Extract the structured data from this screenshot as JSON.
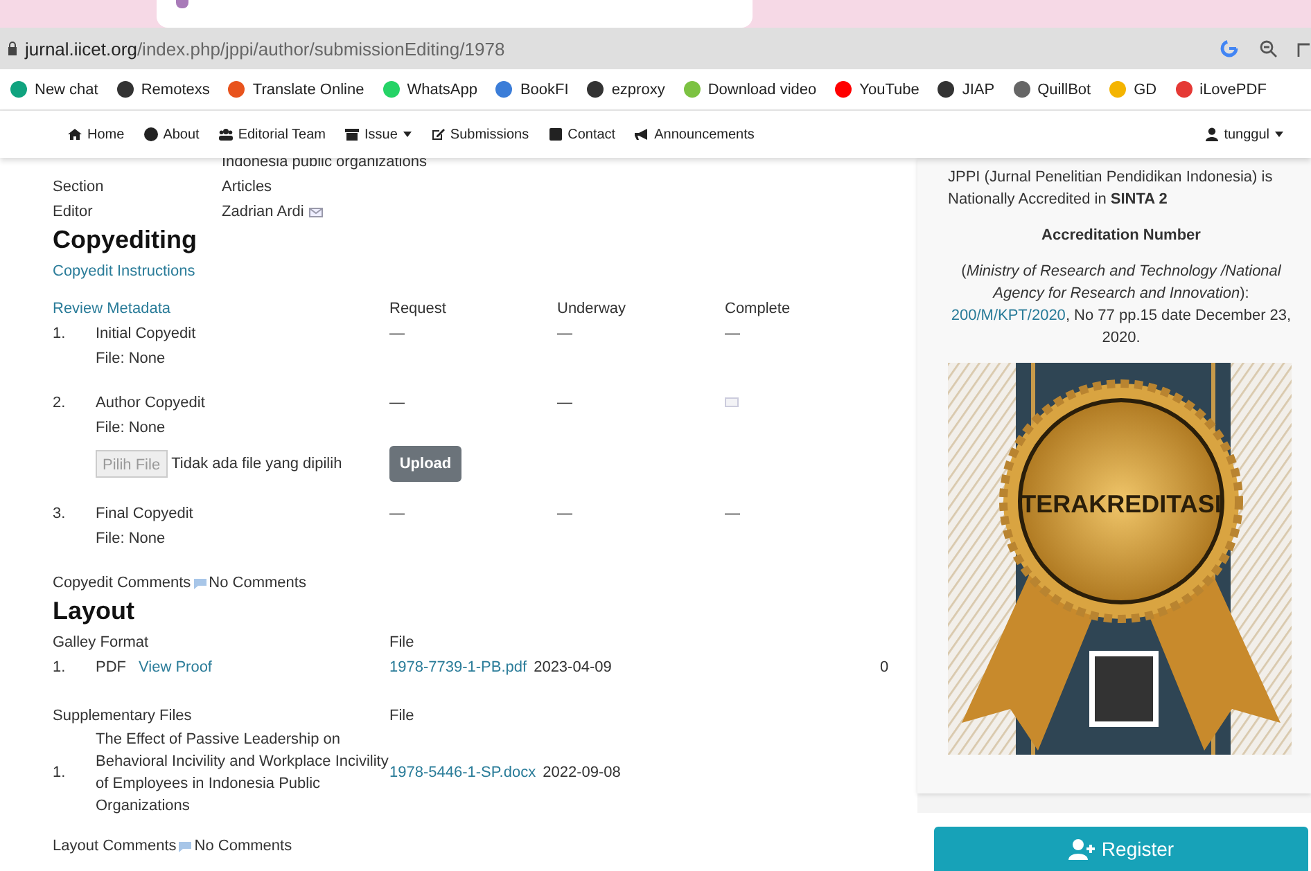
{
  "browser": {
    "url_host": "jurnal.iicet.org",
    "url_path": "/index.php/jppi/author/submissionEditing/1978",
    "bookmarks": [
      "New chat",
      "Remotexs",
      "Translate Online",
      "WhatsApp",
      "BookFI",
      "ezproxy",
      "Download video",
      "YouTube",
      "JIAP",
      "QuillBot",
      "GD",
      "iLovePDF"
    ]
  },
  "nav": {
    "items": [
      {
        "label": "Home",
        "dropdown": false
      },
      {
        "label": "About",
        "dropdown": false
      },
      {
        "label": "Editorial Team",
        "dropdown": false
      },
      {
        "label": "Issue",
        "dropdown": true
      },
      {
        "label": "Submissions",
        "dropdown": false
      },
      {
        "label": "Contact",
        "dropdown": false
      },
      {
        "label": "Announcements",
        "dropdown": false
      }
    ],
    "user": {
      "label": "tunggul",
      "dropdown": true
    }
  },
  "summary": {
    "title_tail": "Indonesia public organizations",
    "rows": [
      {
        "label": "Section",
        "value": "Articles",
        "email": false
      },
      {
        "label": "Editor",
        "value": "Zadrian Ardi",
        "email": true
      }
    ]
  },
  "copyediting": {
    "heading": "Copyediting",
    "instructions_link": "Copyedit Instructions",
    "columns": [
      "Review Metadata",
      "Request",
      "Underway",
      "Complete"
    ],
    "steps": [
      {
        "number": "1.",
        "title": "Initial Copyedit",
        "file": "File: None",
        "request": "—",
        "underway": "—",
        "complete": "—",
        "complete_email": false,
        "upload": false
      },
      {
        "number": "2.",
        "title": "Author Copyedit",
        "file": "File: None",
        "request": "—",
        "underway": "—",
        "complete_email": true,
        "upload": true
      },
      {
        "number": "3.",
        "title": "Final Copyedit",
        "file": "File: None",
        "request": "—",
        "underway": "—",
        "complete": "—",
        "complete_email": false,
        "upload": false
      }
    ],
    "upload": {
      "choose_button": "Pilih File",
      "no_file": "Tidak ada file yang dipilih",
      "button": "Upload"
    },
    "comments_label": "Copyedit Comments",
    "comments_link": "No Comments"
  },
  "layout": {
    "heading": "Layout",
    "galley_columns": [
      "Galley Format",
      "File"
    ],
    "galleys": [
      {
        "number": "1.",
        "format": "PDF",
        "proof_link": "View Proof",
        "file": "1978-7739-1-PB.pdf",
        "date": "2023-04-09",
        "count": "0"
      }
    ],
    "supp_columns": [
      "Supplementary Files",
      "File"
    ],
    "supp_files": [
      {
        "number": "1.",
        "title": "The Effect of Passive Leadership on Behavioral Incivility and Workplace Incivility of Employees in Indonesia Public Organizations",
        "file": "1978-5446-1-SP.docx",
        "date": "2022-09-08"
      }
    ],
    "comments_label": "Layout Comments",
    "comments_link": "No Comments"
  },
  "sidebar": {
    "accreditation_text": "JPPI (Jurnal Penelitian Pendidikan Indonesia) is Nationally Accredited in **SINTA 2**",
    "number_heading": "Accreditation Number",
    "decree_prefix": "(*Ministry of Research and Technology /National Agency for Research and Innovation*):",
    "decree_link": "200/M/KPT/2020",
    "decree_suffix": ", No 77 pp.15 date December 23, 2020.",
    "badge_text": "TERAKREDITASI",
    "register_button": "Register"
  }
}
